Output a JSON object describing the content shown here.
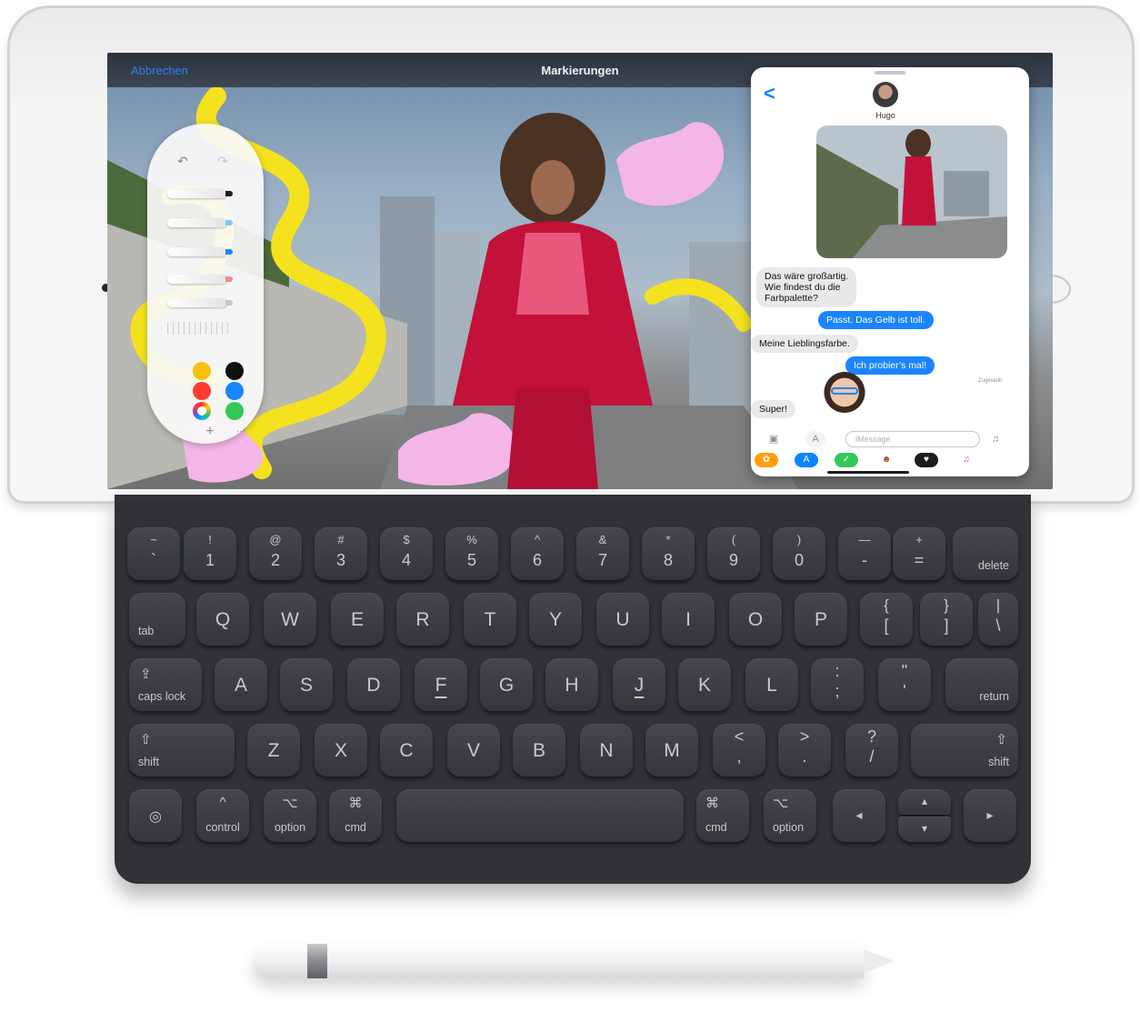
{
  "markup": {
    "cancel_label": "Abbrechen",
    "title": "Markierungen",
    "palette": {
      "add_symbol": "+",
      "more_symbol": "···",
      "colors": [
        "#f7c20f",
        "#101010",
        "#ff3b30",
        "#1b84ff",
        "color-wheel",
        "#34c759"
      ]
    }
  },
  "messages": {
    "contact_name": "Hugo",
    "back_symbol": "<",
    "bubbles": [
      {
        "side": "in",
        "text": "Das wäre großartig.\nWie findest du die\nFarbpalette?"
      },
      {
        "side": "out",
        "text": "Passt. Das Gelb ist toll."
      },
      {
        "side": "in",
        "text": "Meine Lieblingsfarbe."
      },
      {
        "side": "out",
        "text": "Ich probier’s mal!"
      },
      {
        "side": "in",
        "text": "Super!"
      }
    ],
    "delivered_label": "Zugestellt",
    "input_placeholder": "iMessage"
  },
  "keyboard": {
    "rows": [
      [
        {
          "top": "~",
          "bottom": "`"
        },
        {
          "top": "!",
          "bottom": "1"
        },
        {
          "top": "@",
          "bottom": "2"
        },
        {
          "top": "#",
          "bottom": "3"
        },
        {
          "top": "$",
          "bottom": "4"
        },
        {
          "top": "%",
          "bottom": "5"
        },
        {
          "top": "^",
          "bottom": "6"
        },
        {
          "top": "&",
          "bottom": "7"
        },
        {
          "top": "*",
          "bottom": "8"
        },
        {
          "top": "(",
          "bottom": "9"
        },
        {
          "top": ")",
          "bottom": "0"
        },
        {
          "top": "—",
          "bottom": "-"
        },
        {
          "top": "+",
          "bottom": "="
        },
        {
          "word": "delete"
        }
      ],
      [
        {
          "word": "tab"
        },
        {
          "main": "Q"
        },
        {
          "main": "W"
        },
        {
          "main": "E"
        },
        {
          "main": "R"
        },
        {
          "main": "T"
        },
        {
          "main": "Y"
        },
        {
          "main": "U"
        },
        {
          "main": "I"
        },
        {
          "main": "O"
        },
        {
          "main": "P"
        },
        {
          "top": "{",
          "bottom": "["
        },
        {
          "top": "}",
          "bottom": "]"
        },
        {
          "top": "|",
          "bottom": "\\"
        }
      ],
      [
        {
          "word": "caps lock",
          "symbol": "⇪"
        },
        {
          "main": "A"
        },
        {
          "main": "S"
        },
        {
          "main": "D"
        },
        {
          "main": "F"
        },
        {
          "main": "G"
        },
        {
          "main": "H"
        },
        {
          "main": "J"
        },
        {
          "main": "K"
        },
        {
          "main": "L"
        },
        {
          "top": ":",
          "bottom": ";"
        },
        {
          "top": "\"",
          "bottom": "'"
        },
        {
          "word": "return"
        }
      ],
      [
        {
          "word": "shift",
          "symbol": "⇧"
        },
        {
          "main": "Z"
        },
        {
          "main": "X"
        },
        {
          "main": "C"
        },
        {
          "main": "V"
        },
        {
          "main": "B"
        },
        {
          "main": "N"
        },
        {
          "main": "M"
        },
        {
          "top": "<",
          "bottom": ","
        },
        {
          "top": ">",
          "bottom": "."
        },
        {
          "top": "?",
          "bottom": "/"
        },
        {
          "word": "shift",
          "symbol": "⇧"
        }
      ],
      [
        {
          "symbol": "◎"
        },
        {
          "word": "control",
          "symbol": "^"
        },
        {
          "word": "option",
          "symbol": "⌥"
        },
        {
          "word": "cmd",
          "symbol": "⌘"
        },
        {
          "word": ""
        },
        {
          "word": "cmd",
          "symbol": "⌘"
        },
        {
          "word": "option",
          "symbol": "⌥"
        },
        {
          "symbol": "◂"
        },
        {
          "top": "▴",
          "bottom": "▾"
        },
        {
          "symbol": "▸"
        }
      ]
    ]
  }
}
